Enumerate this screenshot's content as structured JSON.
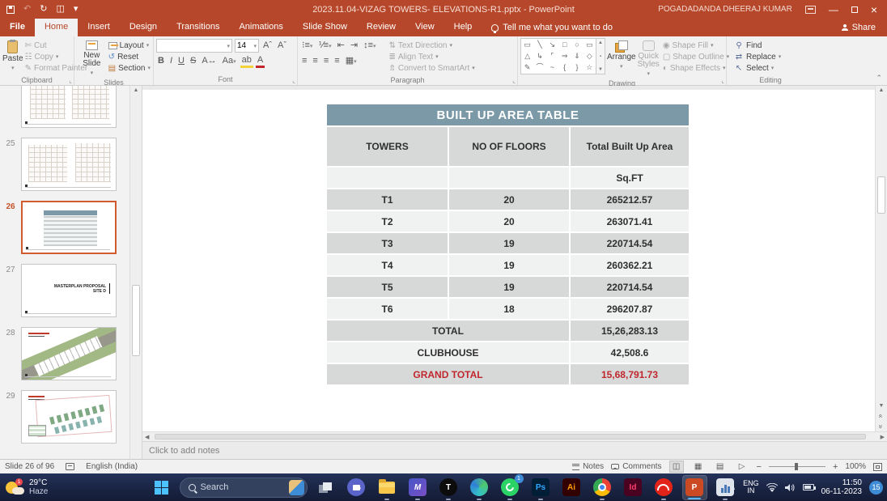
{
  "titlebar": {
    "title": "2023.11.04-VIZAG TOWERS- ELEVATIONS-R1.pptx  -  PowerPoint",
    "user": "POGADADANDA DHEERAJ KUMAR"
  },
  "ribbon": {
    "tabs": [
      "File",
      "Home",
      "Insert",
      "Design",
      "Transitions",
      "Animations",
      "Slide Show",
      "Review",
      "View",
      "Help"
    ],
    "tell_me": "Tell me what you want to do",
    "share": "Share",
    "clipboard": {
      "label": "Clipboard",
      "paste": "Paste",
      "cut": "Cut",
      "copy": "Copy",
      "format_painter": "Format Painter"
    },
    "slides": {
      "label": "Slides",
      "new_slide": "New Slide",
      "layout": "Layout",
      "reset": "Reset",
      "section": "Section"
    },
    "font": {
      "label": "Font",
      "size": "14",
      "bold": "B",
      "italic": "I",
      "underline": "U",
      "strike": "S"
    },
    "paragraph": {
      "label": "Paragraph",
      "text_direction": "Text Direction",
      "align_text": "Align Text",
      "convert": "Convert to SmartArt"
    },
    "drawing": {
      "label": "Drawing",
      "arrange": "Arrange",
      "quick_styles": "Quick Styles",
      "shape_fill": "Shape Fill",
      "shape_outline": "Shape Outline",
      "shape_effects": "Shape Effects"
    },
    "editing": {
      "label": "Editing",
      "find": "Find",
      "replace": "Replace",
      "select": "Select"
    }
  },
  "thumbnails": {
    "items": [
      {
        "number": ""
      },
      {
        "number": "25"
      },
      {
        "number": "26"
      },
      {
        "number": "27"
      },
      {
        "number": "28"
      },
      {
        "number": "29"
      }
    ],
    "slide27_line1": "MASTERPLAN PROPOSAL",
    "slide27_line2": "SITE D"
  },
  "table": {
    "title": "BUILT UP AREA TABLE",
    "headers": [
      "TOWERS",
      "NO OF FLOORS",
      "Total Built Up Area"
    ],
    "unit": "Sq.FT",
    "rows": [
      {
        "tower": "T1",
        "floors": "20",
        "area": "265212.57"
      },
      {
        "tower": "T2",
        "floors": "20",
        "area": "263071.41"
      },
      {
        "tower": "T3",
        "floors": "19",
        "area": "220714.54"
      },
      {
        "tower": "T4",
        "floors": "19",
        "area": "260362.21"
      },
      {
        "tower": "T5",
        "floors": "19",
        "area": "220714.54"
      },
      {
        "tower": "T6",
        "floors": "18",
        "area": "296207.87"
      }
    ],
    "total": {
      "label": "TOTAL",
      "value": "15,26,283.13"
    },
    "clubhouse": {
      "label": "CLUBHOUSE",
      "value": "42,508.6"
    },
    "grand_total": {
      "label": "GRAND TOTAL",
      "value": "15,68,791.73"
    },
    "colors": {
      "header_bg": "#7b99a6",
      "row_gray": "#d7d9d9",
      "row_light": "#f0f1f1",
      "grand_total_red": "#c0272d"
    }
  },
  "notes": {
    "placeholder": "Click to add notes"
  },
  "statusbar": {
    "slide_info": "Slide 26 of 96",
    "language": "English (India)",
    "notes": "Notes",
    "comments": "Comments",
    "zoom": "100%"
  },
  "taskbar": {
    "weather": {
      "temp": "29°C",
      "condition": "Haze",
      "badge": "1"
    },
    "search": {
      "placeholder": "Search"
    },
    "badges": {
      "whatsapp": "1",
      "notifications": "15"
    },
    "apps": {
      "photoshop": "Ps",
      "illustrator": "Ai",
      "indesign": "Id",
      "powerpoint": "P",
      "t_app": "T",
      "m_app": "M"
    },
    "tray": {
      "lang_top": "ENG",
      "lang_bottom": "IN",
      "time": "11:50",
      "date": "06-11-2023"
    }
  }
}
